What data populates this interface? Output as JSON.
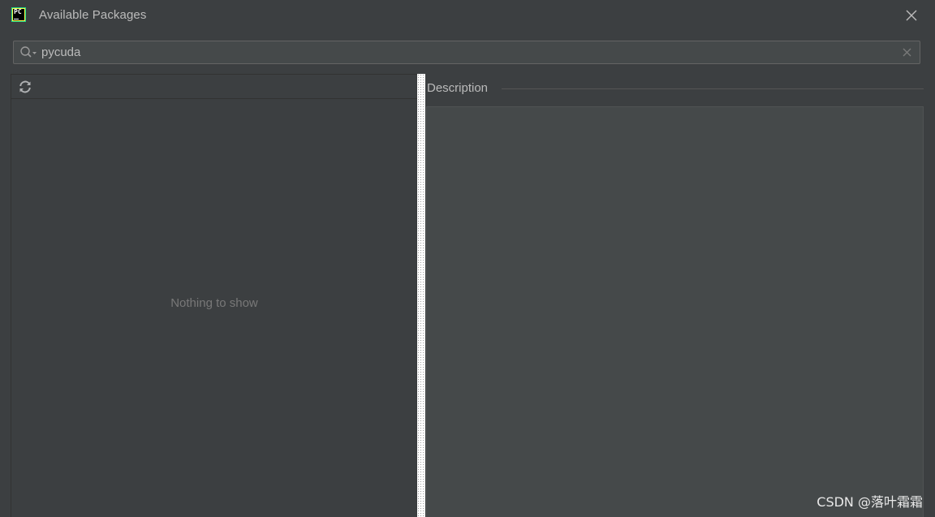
{
  "window": {
    "title": "Available Packages",
    "logo_text": "PC",
    "icons": {
      "logo": "pycharm-logo-icon",
      "close": "close-icon"
    }
  },
  "search": {
    "value": "pycuda",
    "placeholder": "",
    "icons": {
      "search": "search-icon",
      "clear": "clear-icon"
    }
  },
  "package_list": {
    "empty_text": "Nothing to show",
    "icons": {
      "refresh": "refresh-icon"
    }
  },
  "description": {
    "label": "Description",
    "content": ""
  },
  "watermark": {
    "text": "CSDN @落叶霜霜"
  },
  "colors": {
    "background": "#3c3f41",
    "field": "#45494a",
    "text": "#bbbbbb",
    "muted_text": "#787878"
  }
}
